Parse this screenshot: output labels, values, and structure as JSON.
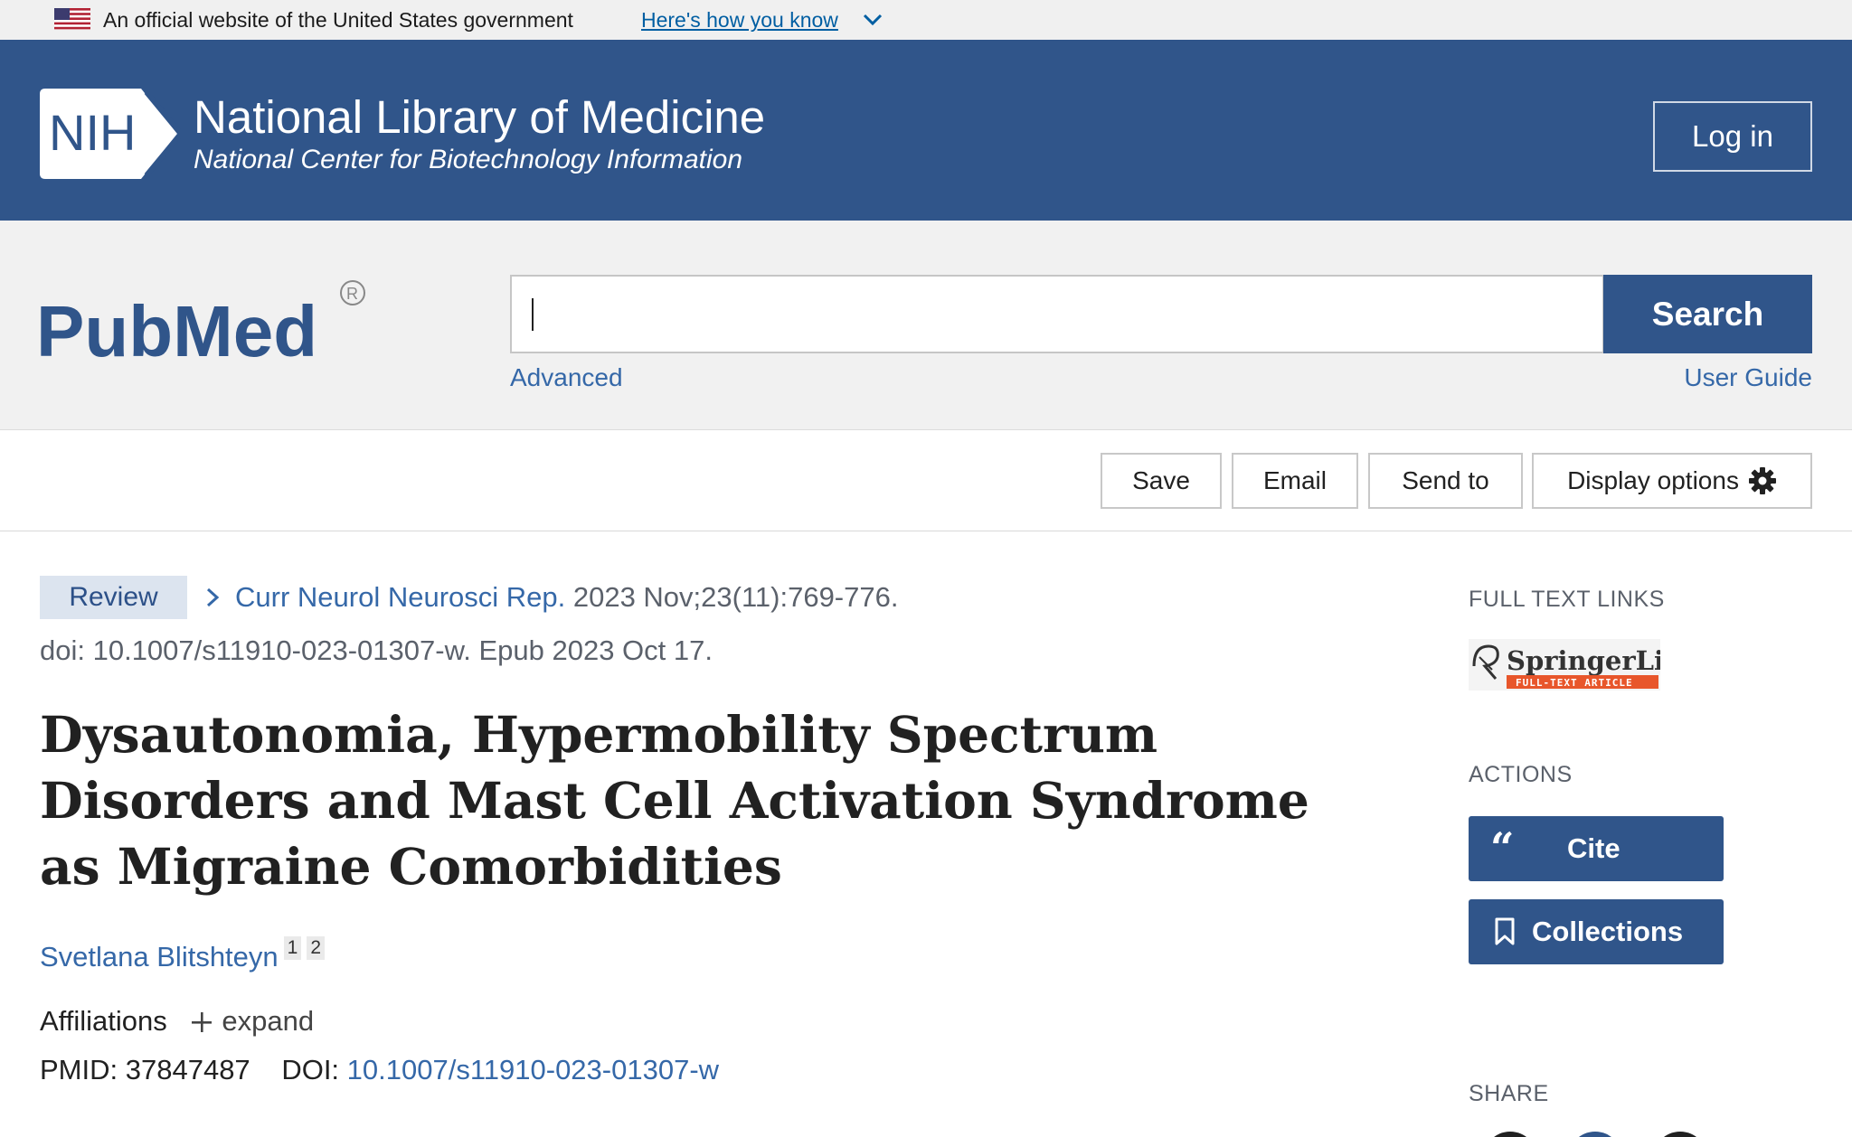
{
  "gov_banner": {
    "text": "An official website of the United States government",
    "link": "Here's how you know"
  },
  "header": {
    "logo_text": "NIH",
    "title": "National Library of Medicine",
    "subtitle": "National Center for Biotechnology Information",
    "login": "Log in",
    "color": "#30558a"
  },
  "search": {
    "logo_text": "PubMed",
    "value": "",
    "button": "Search",
    "advanced": "Advanced",
    "user_guide": "User Guide"
  },
  "toolbar": {
    "save": "Save",
    "email": "Email",
    "send_to": "Send to",
    "display_options": "Display options"
  },
  "article": {
    "badge": "Review",
    "journal": "Curr Neurol Neurosci Rep.",
    "citation": " 2023 Nov;23(11):769-776.",
    "doi_line": "doi: 10.1007/s11910-023-01307-w. Epub 2023 Oct 17.",
    "title": "Dysautonomia, Hypermobility Spectrum Disorders and Mast Cell Activation Syndrome as Migraine Comorbidities",
    "author": "Svetlana Blitshteyn",
    "affiliation_refs": [
      "1",
      "2"
    ],
    "affiliations_label": "Affiliations",
    "expand_label": "expand",
    "pmid_label": "PMID:",
    "pmid": "37847487",
    "doi_label": "DOI:",
    "doi": "10.1007/s11910-023-01307-w"
  },
  "sidebar": {
    "full_text_heading": "FULL TEXT LINKS",
    "springer_name": "SpringerLink",
    "springer_tag": "FULL-TEXT ARTICLE",
    "actions_heading": "ACTIONS",
    "cite": "Cite",
    "collections": "Collections",
    "share_heading": "SHARE"
  }
}
